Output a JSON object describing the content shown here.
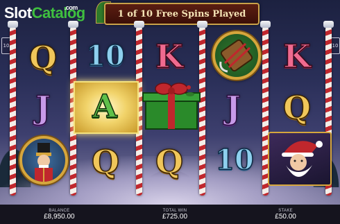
{
  "logo": {
    "part1": "Slot",
    "part2": "Catalog",
    "suffix": ".com"
  },
  "banner": {
    "text": "1 of 10 Free Spins Played"
  },
  "side_icons": {
    "left": "10",
    "right": "10"
  },
  "reels": [
    [
      "Q",
      "J",
      "nutcracker"
    ],
    [
      "10",
      "A",
      "Q"
    ],
    [
      "K",
      "gift",
      "Q"
    ],
    [
      "sled",
      "J",
      "10"
    ],
    [
      "K",
      "Q",
      "santa"
    ]
  ],
  "symbols": {
    "r1_top": "Q",
    "r1_mid": "J",
    "r2_top": "10",
    "r2_mid": "A",
    "r2_bot": "Q",
    "r3_top": "K",
    "r3_bot": "Q",
    "r4_mid": "J",
    "r4_bot": "10",
    "r5_top": "K",
    "r5_mid": "Q"
  },
  "footer": {
    "balance_label": "BALANCE",
    "balance_value": "£8,950.00",
    "totalwin_label": "TOTAL WIN",
    "totalwin_value": "£725.00",
    "stake_label": "STAKE",
    "stake_value": "£50.00"
  },
  "colors": {
    "gold": "#f0c65a",
    "candy_red": "#c0272d",
    "banner_bg": "#5b1e12",
    "highlight": "#f1d36a",
    "footer_bg": "#15141e"
  }
}
